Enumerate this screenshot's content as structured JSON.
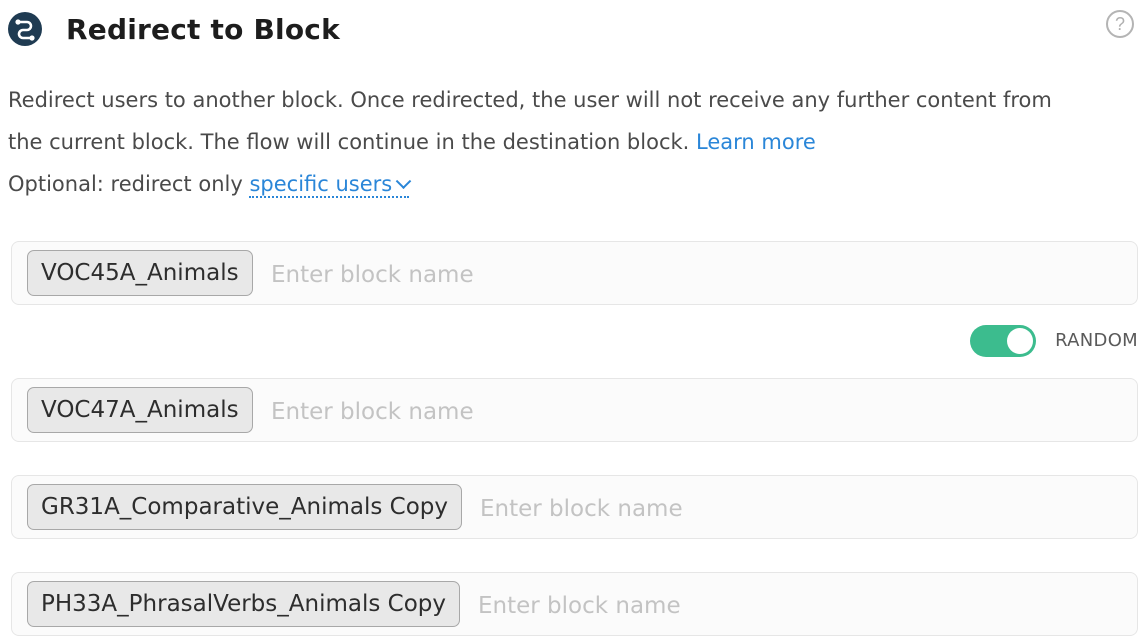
{
  "header": {
    "icon": "redirect-icon",
    "title": "Redirect to Block",
    "help_icon": "question-icon",
    "help_glyph": "?"
  },
  "description": {
    "line1": "Redirect users to another block. Once redirected, the user will not receive any further content from",
    "line2": "the current block. The flow will continue in the destination block.",
    "learn_more": "Learn more",
    "optional_prefix": "Optional: redirect only",
    "specific_users": "specific users"
  },
  "random": {
    "label": "RANDOM",
    "enabled": true
  },
  "blocks": [
    {
      "chip": "VOC45A_Animals",
      "value": "",
      "placeholder": "Enter block name"
    },
    {
      "chip": "VOC47A_Animals",
      "value": "",
      "placeholder": "Enter block name"
    },
    {
      "chip": "GR31A_Comparative_Animals Copy",
      "value": "",
      "placeholder": "Enter block name"
    },
    {
      "chip": "PH33A_PhrasalVerbs_Animals Copy",
      "value": "",
      "placeholder": "Enter block name"
    }
  ],
  "colors": {
    "accent": "#2a86d8",
    "toggle_on": "#3cbc8e",
    "header_icon": "#1f3b52"
  }
}
